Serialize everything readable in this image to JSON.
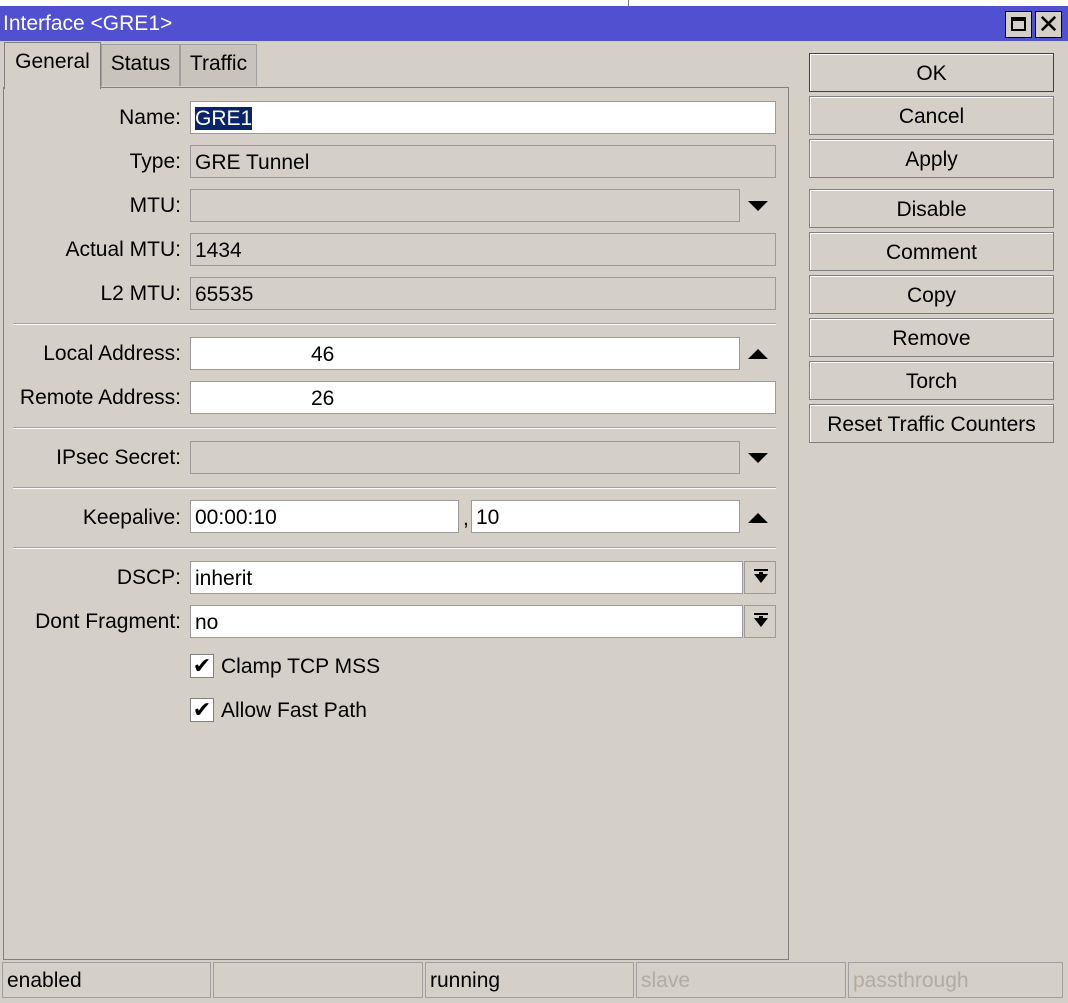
{
  "window": {
    "title": "Interface <GRE1>"
  },
  "tabs": [
    {
      "label": "General"
    },
    {
      "label": "Status"
    },
    {
      "label": "Traffic"
    }
  ],
  "form": {
    "name": {
      "label": "Name:",
      "value": "GRE1"
    },
    "type": {
      "label": "Type:",
      "value": "GRE Tunnel"
    },
    "mtu": {
      "label": "MTU:",
      "value": ""
    },
    "actual_mtu": {
      "label": "Actual MTU:",
      "value": "1434"
    },
    "l2_mtu": {
      "label": "L2 MTU:",
      "value": "65535"
    },
    "local_address": {
      "label": "Local Address:",
      "value": "46"
    },
    "remote_address": {
      "label": "Remote Address:",
      "value": "26"
    },
    "ipsec_secret": {
      "label": "IPsec Secret:",
      "value": ""
    },
    "keepalive": {
      "label": "Keepalive:",
      "interval": "00:00:10",
      "separator": ",",
      "retries": "10"
    },
    "dscp": {
      "label": "DSCP:",
      "value": "inherit"
    },
    "dont_fragment": {
      "label": "Dont Fragment:",
      "value": "no"
    },
    "clamp_tcp_mss": {
      "label": "Clamp TCP MSS",
      "checked": true,
      "mark": "✔"
    },
    "allow_fast_path": {
      "label": "Allow Fast Path",
      "checked": true,
      "mark": "✔"
    }
  },
  "buttons": {
    "ok": "OK",
    "cancel": "Cancel",
    "apply": "Apply",
    "disable": "Disable",
    "comment": "Comment",
    "copy": "Copy",
    "remove": "Remove",
    "torch": "Torch",
    "reset_traffic_counters": "Reset Traffic Counters"
  },
  "status_bar": {
    "enabled": "enabled",
    "blank": "",
    "running": "running",
    "slave": "slave",
    "passthrough": "passthrough"
  },
  "colors": {
    "titlebar": "#5050d0",
    "window_bg": "#d4d0c8",
    "selection": "#0a246a"
  }
}
